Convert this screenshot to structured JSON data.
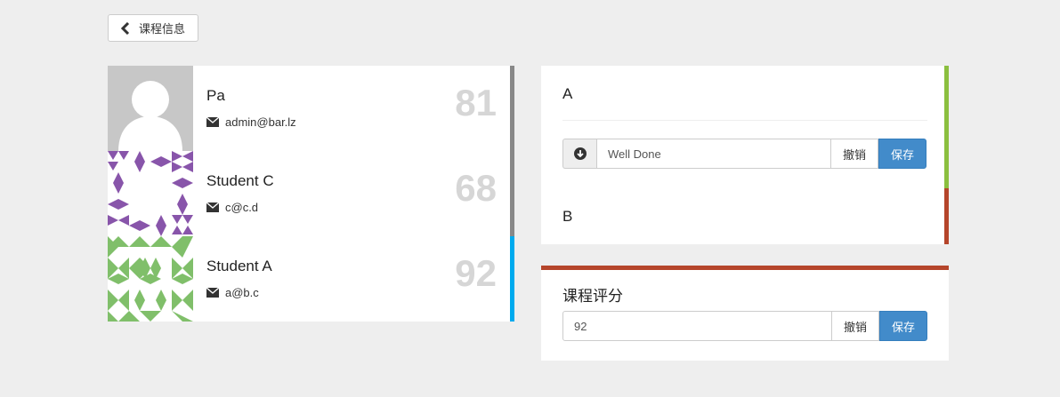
{
  "header": {
    "back_label": "课程信息"
  },
  "students": [
    {
      "name": "Pa",
      "email": "admin@bar.lz",
      "score": "81",
      "bar_color": "#888888"
    },
    {
      "name": "Student C",
      "email": "c@c.d",
      "score": "68",
      "bar_color": "#888888"
    },
    {
      "name": "Student A",
      "email": "a@b.c",
      "score": "92",
      "bar_color": "#00aaee"
    }
  ],
  "grading": {
    "label_a": "A",
    "label_b": "B",
    "comment_value": "Well Done",
    "cancel_label": "撤销",
    "save_label": "保存",
    "accent_top": "#8bbf3f",
    "accent_bottom": "#b5452b"
  },
  "course_score": {
    "title": "课程评分",
    "value": "92",
    "cancel_label": "撤销",
    "save_label": "保存",
    "accent": "#b5452b"
  },
  "icons": {
    "back": "chevron-left-icon",
    "email": "envelope-icon",
    "addon": "arrow-circle-down-icon"
  }
}
